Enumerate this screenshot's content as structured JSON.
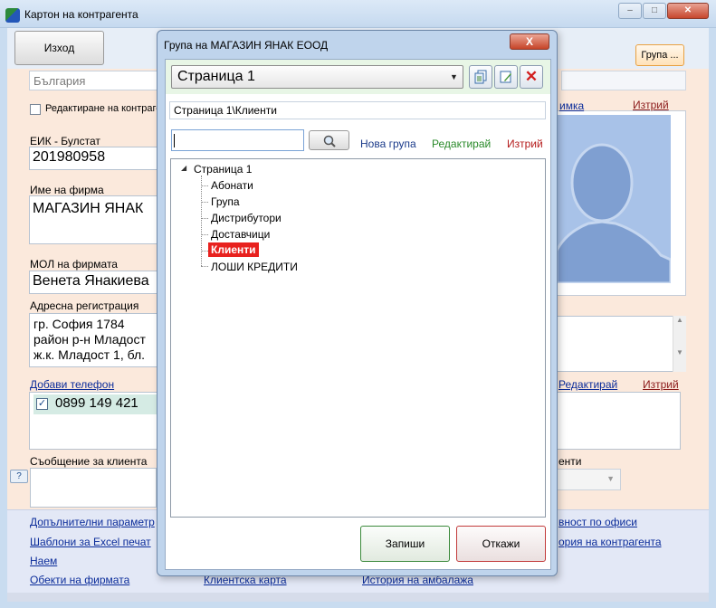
{
  "main_window": {
    "title": "Картон на контрагента",
    "exit_label": "Изход",
    "group_button_label": "Група ...",
    "country_value": "България",
    "edit_checkbox_label": "Редактиране на контраге",
    "eik_label": "ЕИК - Булстат",
    "eik_value": "201980958",
    "company_name_label": "Име на фирма",
    "company_name_value": "МАГАЗИН ЯНАК",
    "mol_label": "МОЛ на фирмата",
    "mol_value": "Венета Янакиева",
    "address_label": "Адресна регистрация",
    "address_lines": [
      "гр. София 1784",
      "район р-н Младост",
      "ж.к. Младост 1, бл."
    ],
    "photo_link_fragment": "имка",
    "photo_delete_label": "Изтрий",
    "add_phone_label": "Добави телефон",
    "phone_value": "0899 149 421",
    "phone_edit_label": "Редактирай",
    "phone_delete_label": "Изтрий",
    "message_label": "Съобщение за клиента",
    "help_label": "?",
    "right_combo_label_fragment": "енти",
    "links": {
      "additional_params": "Допълнителни параметр",
      "excel_templates": "Шаблони за Excel печат",
      "rent": "Наем",
      "objects": "Обекти на фирмата",
      "client_card": "Клиентска карта",
      "packaging_history": "История на амбалажа",
      "offices_activity": "вност по офиси",
      "contragent_history": "ория на контрагента"
    }
  },
  "dialog": {
    "title": "Група на МАГАЗИН ЯНАК ЕООД",
    "close_label": "X",
    "page_select_value": "Страница 1",
    "path_value": "Страница 1\\Клиенти",
    "search_value": "",
    "new_group_label": "Нова група",
    "edit_label": "Редактирай",
    "delete_label": "Изтрий",
    "tree": {
      "root": "Страница 1",
      "children": [
        "Абонати",
        "Група",
        "Дистрибутори",
        "Доставчици",
        "Клиенти",
        "ЛОШИ КРЕДИТИ"
      ],
      "selected": "Клиенти"
    },
    "save_label": "Запиши",
    "cancel_label": "Откажи"
  },
  "colors": {
    "selected_bg": "#e8211e",
    "new_group": "#1a3a8a",
    "edit": "#2a8a2a",
    "delete": "#b51c1c"
  }
}
